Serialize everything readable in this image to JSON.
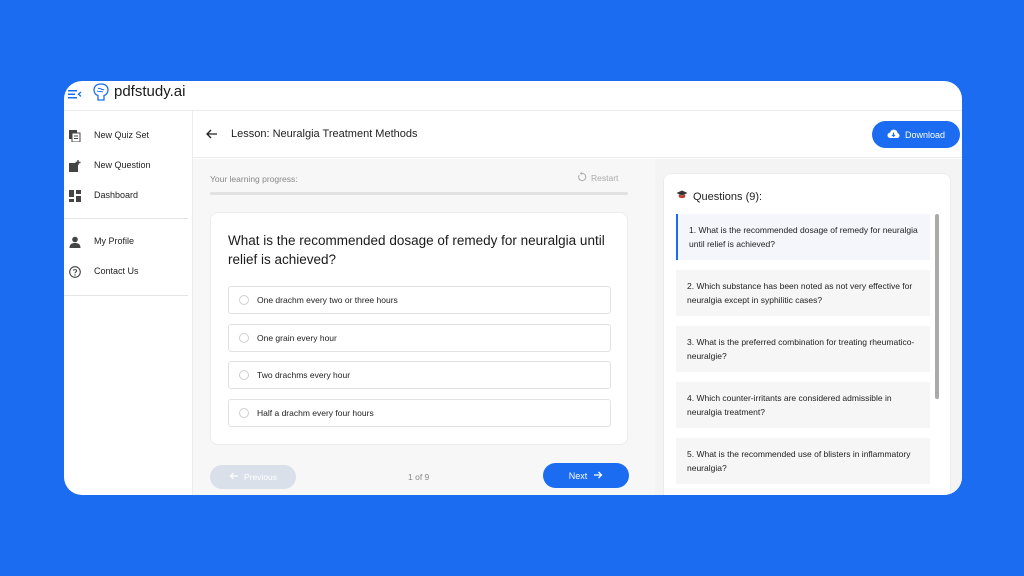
{
  "app": {
    "brand": "pdfstudy.ai"
  },
  "sidebar": {
    "items": [
      {
        "label": "New Quiz Set",
        "icon": "quiz-set-icon"
      },
      {
        "label": "New Question",
        "icon": "new-question-icon"
      },
      {
        "label": "Dashboard",
        "icon": "dashboard-icon"
      },
      {
        "label": "My Profile",
        "icon": "profile-icon"
      },
      {
        "label": "Contact Us",
        "icon": "help-icon"
      }
    ]
  },
  "header": {
    "title": "Lesson: Neuralgia Treatment Methods",
    "download_label": "Download"
  },
  "main": {
    "progress_label": "Your learning progress:",
    "restart_label": "Restart",
    "progress_fraction": 0,
    "question": "What is the recommended dosage of remedy for neuralgia until relief is achieved?",
    "options": [
      "One drachm every two or three hours",
      "One grain every hour",
      "Two drachms every hour",
      "Half a drachm every four hours"
    ],
    "prev_label": "Previous",
    "page_count": "1 of 9",
    "next_label": "Next"
  },
  "questions_panel": {
    "title": "Questions (9):",
    "items": [
      "1. What is the recommended dosage of remedy for neuralgia until relief is achieved?",
      "2. Which substance has been noted as not very effective for neuralgia except in syphilitic cases?",
      "3. What is the preferred combination for treating rheumatico-neuralgie?",
      "4. Which counter-irritants are considered admissible in neuralgia treatment?",
      "5. What is the recommended use of blisters in inflammatory neuralgia?"
    ]
  },
  "colors": {
    "accent": "#1b6cf0",
    "background": "#1b6cf0"
  }
}
